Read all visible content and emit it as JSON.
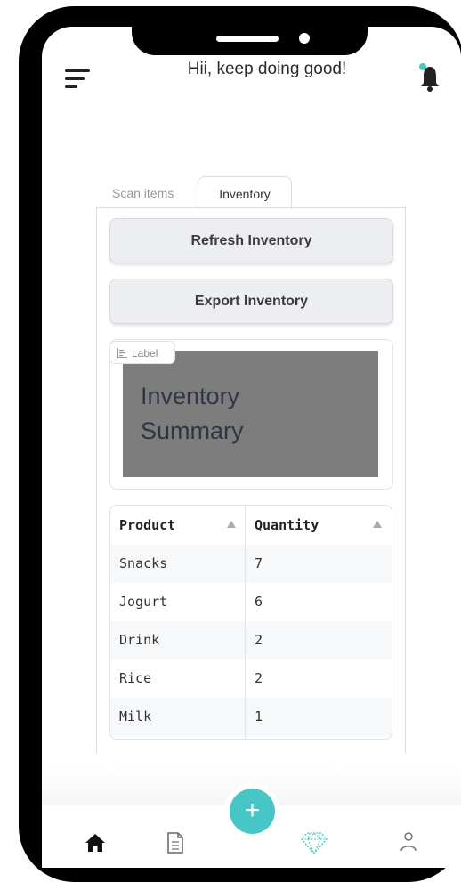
{
  "header": {
    "greeting": "Hii, keep doing good!"
  },
  "tabs": [
    {
      "label": "Scan items",
      "active": false
    },
    {
      "label": "Inventory",
      "active": true
    }
  ],
  "buttons": {
    "refresh": "Refresh Inventory",
    "export": "Export Inventory"
  },
  "label_block": {
    "tag": "Label",
    "line1": "Inventory",
    "line2": "Summary"
  },
  "table": {
    "headers": [
      "Product",
      "Quantity"
    ],
    "rows": [
      [
        "Snacks",
        "7"
      ],
      [
        "Jogurt",
        "6"
      ],
      [
        "Drink",
        "2"
      ],
      [
        "Rice",
        "2"
      ],
      [
        "Milk",
        "1"
      ]
    ]
  },
  "fab": {
    "label": "+"
  },
  "colors": {
    "accent": "#46c6c6",
    "bell_dot": "#46c6c6",
    "summary_bg": "#7d7d7d"
  },
  "nav": {
    "items": [
      {
        "icon": "home-icon",
        "active": true
      },
      {
        "icon": "document-icon",
        "active": false
      },
      {
        "icon": "diamond-icon",
        "active": false
      },
      {
        "icon": "user-icon",
        "active": false
      }
    ]
  }
}
